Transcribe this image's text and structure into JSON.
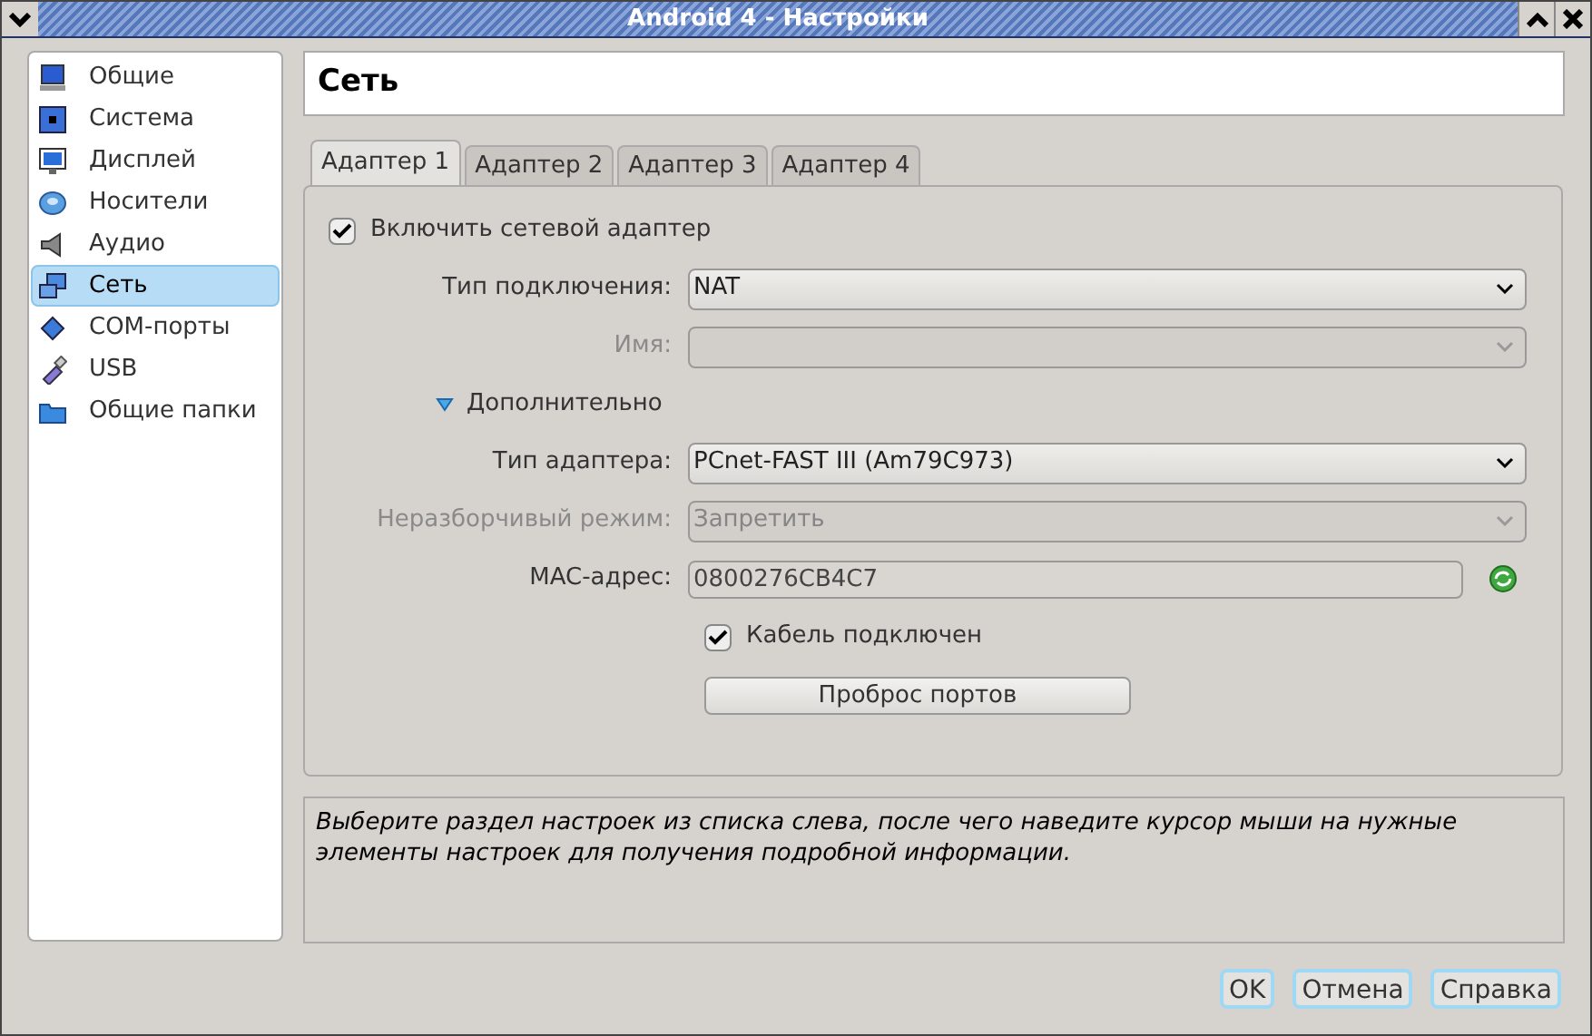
{
  "window": {
    "title": "Android 4 - Настройки"
  },
  "sidebar": {
    "items": [
      {
        "label": "Общие",
        "selected": false
      },
      {
        "label": "Система",
        "selected": false
      },
      {
        "label": "Дисплей",
        "selected": false
      },
      {
        "label": "Носители",
        "selected": false
      },
      {
        "label": "Аудио",
        "selected": false
      },
      {
        "label": "Сеть",
        "selected": true
      },
      {
        "label": "COM-порты",
        "selected": false
      },
      {
        "label": "USB",
        "selected": false
      },
      {
        "label": "Общие папки",
        "selected": false
      }
    ]
  },
  "page_title": "Сеть",
  "tabs": [
    {
      "label": "Адаптер 1",
      "selected": true
    },
    {
      "label": "Адаптер 2",
      "selected": false
    },
    {
      "label": "Адаптер 3",
      "selected": false
    },
    {
      "label": "Адаптер 4",
      "selected": false
    }
  ],
  "form": [
    {
      "kind": "checkbox",
      "label": "Включить сетевой адаптер",
      "checked": true
    },
    {
      "kind": "select",
      "label": "Тип подключения:",
      "value": "NAT",
      "disabled": false
    },
    {
      "kind": "select",
      "label": "Имя:",
      "disabled": true
    },
    {
      "kind": "expander",
      "label": "Дополнительно",
      "expanded": true
    },
    {
      "kind": "select",
      "label": "Тип адаптера:",
      "value": "PCnet-FAST III (Am79C973)",
      "disabled": false
    },
    {
      "kind": "select",
      "label": "Неразборчивый режим:",
      "value": "Запретить",
      "disabled": true
    },
    {
      "kind": "text",
      "label": "MAC-адрес:",
      "value": "0800276CB4C7"
    },
    {
      "kind": "field_checkbox",
      "label": "Кабель подключен",
      "checked": true
    },
    {
      "kind": "button",
      "label": "Проброс портов"
    }
  ],
  "description": "Выберите раздел настроек из списка слева, после чего наведите курсор мыши на нужные элементы настроек для получения подробной информации.",
  "buttons": [
    "OK",
    "Отмена",
    "Справка"
  ]
}
